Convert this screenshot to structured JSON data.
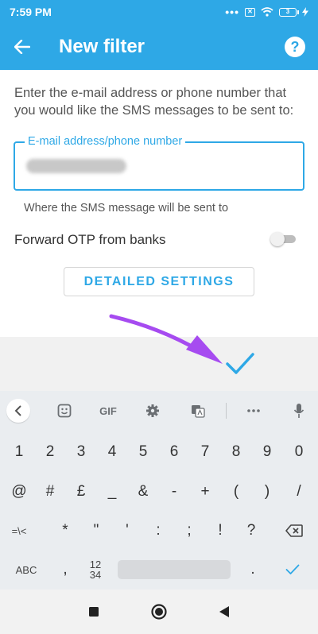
{
  "status_bar": {
    "time": "7:59 PM",
    "battery": "3"
  },
  "app_bar": {
    "title": "New filter",
    "help_glyph": "?"
  },
  "form": {
    "description": "Enter the e-mail address or phone number that you would like the SMS messages to be sent to:",
    "field_label": "E-mail address/phone number",
    "helper_text": "Where the SMS message will be sent to",
    "otp_label": "Forward OTP from banks",
    "otp_enabled": false,
    "detailed_settings_label": "DETAILED SETTINGS"
  },
  "keyboard": {
    "tools": {
      "gif": "GIF"
    },
    "rows": [
      [
        "1",
        "2",
        "3",
        "4",
        "5",
        "6",
        "7",
        "8",
        "9",
        "0"
      ],
      [
        "@",
        "#",
        "£",
        "_",
        "&",
        "-",
        "+",
        "(",
        ")",
        "/"
      ],
      [
        "=\\<",
        "*",
        "\"",
        "'",
        ":",
        ";",
        "!",
        "?"
      ],
      [
        "ABC",
        ",",
        "12\n34",
        ".",
        ""
      ]
    ]
  },
  "colors": {
    "accent": "#2ea8e6",
    "arrow": "#a64bf0"
  },
  "icons": [
    "back-arrow-icon",
    "help-icon",
    "checkmark-icon",
    "collapse-icon",
    "sticker-icon",
    "gear-icon",
    "translate-icon",
    "more-icon",
    "mic-icon",
    "backspace-icon",
    "square-icon",
    "circle-icon",
    "triangle-icon"
  ]
}
